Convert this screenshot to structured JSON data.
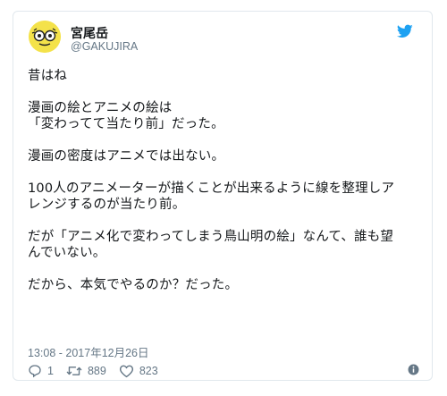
{
  "user": {
    "name": "宮尾岳",
    "handle": "@GAKUJIRA"
  },
  "tweet": {
    "lines": [
      "昔はね",
      "",
      "漫画の絵とアニメの絵は",
      "「変わってて当たり前」だった。",
      "",
      "漫画の密度はアニメでは出ない。",
      "",
      "100人のアニメーターが描くことが出来るように線を整理しア",
      "レンジするのが当たり前。",
      "",
      "だが「アニメ化で変わってしまう鳥山明の絵」なんて、誰も望",
      "んでいない。",
      "",
      "だから、本気でやるのか？だった。"
    ],
    "timestamp": "13:08 - 2017年12月26日"
  },
  "actions": {
    "reply_count": "1",
    "retweet_count": "889",
    "like_count": "823"
  },
  "icons": {
    "brand": "twitter-bird-icon",
    "reply": "reply-icon",
    "retweet": "retweet-icon",
    "like": "heart-icon",
    "info": "info-icon"
  },
  "colors": {
    "twitter_blue": "#1da1f2",
    "secondary_text": "#657786",
    "avatar_yellow": "#f4e24a"
  }
}
